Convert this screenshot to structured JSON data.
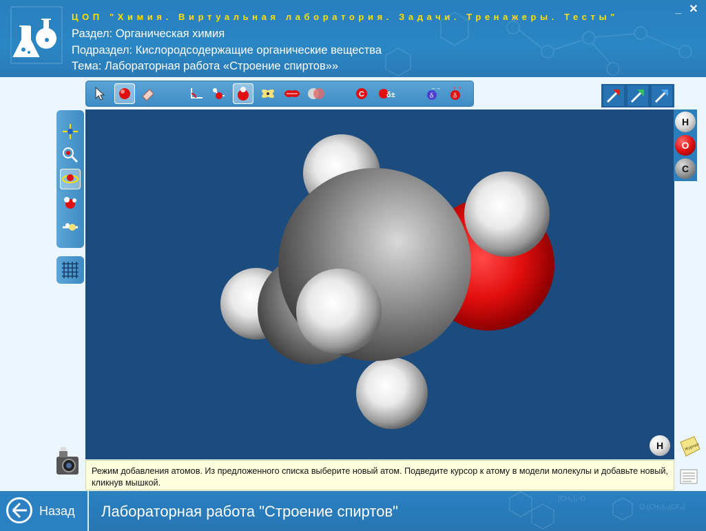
{
  "window": {
    "app_title": "ЦОП \"Химия. Виртуальная лаборатория. Задачи. Тренажеры. Тесты\"",
    "minimize_label": "_",
    "close_label": "✕"
  },
  "header": {
    "section": "Раздел: Органическая химия",
    "subsection": "Подраздел: Кислородсодержащие органические вещества",
    "topic": "Тема: Лабораторная работа «Строение спиртов»»"
  },
  "toolbar": {
    "tools": [
      "select-arrow-icon",
      "add-atom-icon",
      "eraser-icon",
      "bond-angle-icon",
      "ball-stick-icon",
      "space-fill-icon",
      "orbital-icon",
      "pi-bond-icon",
      "atom-overlap-icon",
      "carbon-label-icon",
      "partial-charge-icon",
      "delta-minus-icon",
      "delta-plus-icon"
    ],
    "active_tool": "space-fill-icon",
    "charge_label": "δ±",
    "carbon_label": "C"
  },
  "right_tools": [
    "arrow-red-icon",
    "arrow-green-icon",
    "arrow-blue-icon"
  ],
  "left_toolbar": {
    "tools": [
      "move-icon",
      "zoom-icon",
      "rotate-icon",
      "molecule-icon",
      "split-icon"
    ],
    "active_tool": "rotate-icon",
    "grid_tool": "grid-icon"
  },
  "atom_palette": {
    "atoms": [
      {
        "symbol": "H",
        "color": "#e8e8e8"
      },
      {
        "symbol": "O",
        "color": "#e01010"
      },
      {
        "symbol": "C",
        "color": "#8a8a8a"
      }
    ],
    "selected_atom": "H"
  },
  "molecule": {
    "name": "",
    "atoms": [
      "C",
      "C",
      "O",
      "H",
      "H",
      "H",
      "H",
      "H"
    ]
  },
  "status": {
    "text": "Режим добавления атомов. Из предложенного списка выберите новый атом. Подведите курсор к атому в модели молекулы и добавьте новый, кликнув мышкой."
  },
  "side": {
    "journal_label": "Журнал"
  },
  "footer": {
    "back_label": "Назад",
    "title": "Лабораторная работа \"Строение спиртов\""
  },
  "colors": {
    "header_blue": "#2b86c4",
    "viewport_bg": "#1c4c7d",
    "title_yellow": "#ffe000",
    "status_bg": "#ffffdf"
  }
}
